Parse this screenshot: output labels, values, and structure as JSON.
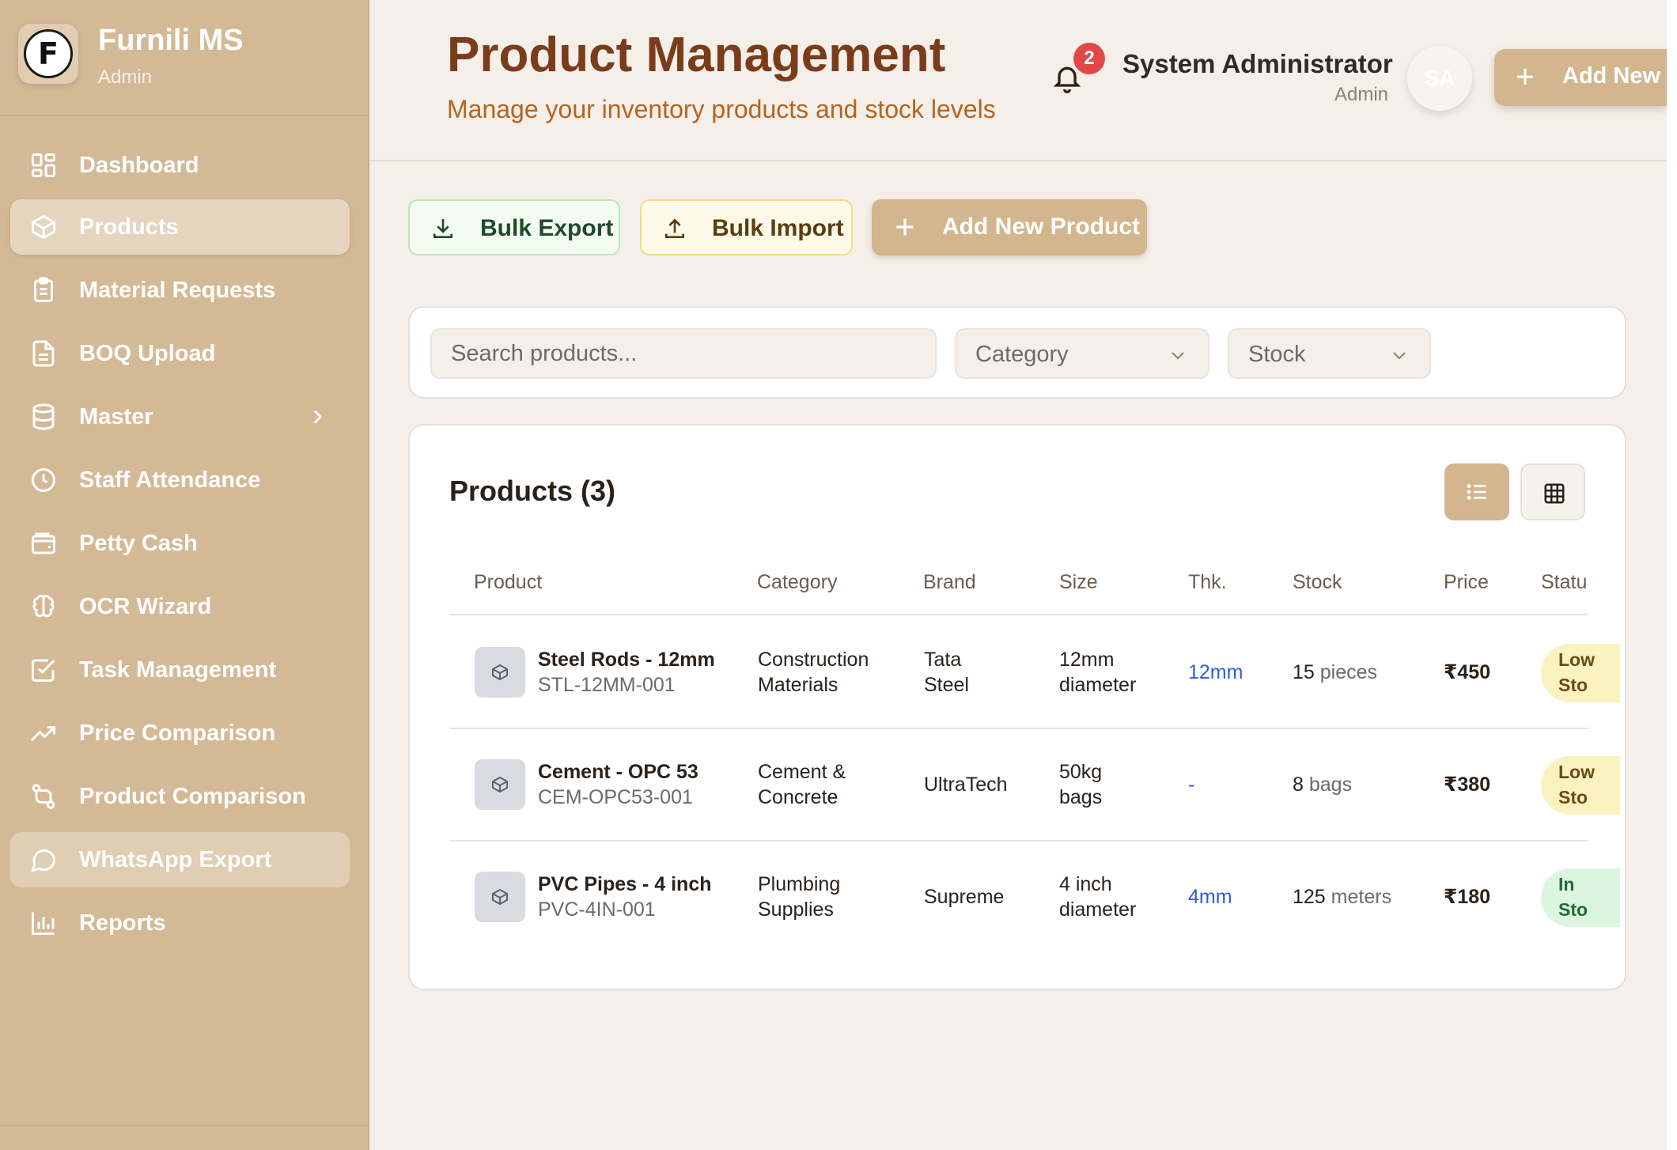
{
  "brand": {
    "name": "Furnili MS",
    "role": "Admin",
    "logo_letter": "F"
  },
  "sidebar": {
    "items": [
      {
        "label": "Dashboard",
        "icon": "dashboard-grid-icon"
      },
      {
        "label": "Products",
        "icon": "box-icon",
        "active": true
      },
      {
        "label": "Material Requests",
        "icon": "clipboard-icon"
      },
      {
        "label": "BOQ Upload",
        "icon": "file-icon"
      },
      {
        "label": "Master",
        "icon": "database-icon",
        "has_submenu": true
      },
      {
        "label": "Staff Attendance",
        "icon": "clock-icon"
      },
      {
        "label": "Petty Cash",
        "icon": "wallet-icon"
      },
      {
        "label": "OCR Wizard",
        "icon": "brain-icon"
      },
      {
        "label": "Task Management",
        "icon": "checkbox-icon"
      },
      {
        "label": "Price Comparison",
        "icon": "trending-up-icon"
      },
      {
        "label": "Product Comparison",
        "icon": "compare-icon"
      },
      {
        "label": "WhatsApp Export",
        "icon": "chat-bubble-icon",
        "highlighted": true
      },
      {
        "label": "Reports",
        "icon": "bar-chart-icon"
      }
    ]
  },
  "header": {
    "title": "Product Management",
    "subtitle": "Manage your inventory products and stock levels",
    "notification_count": "2",
    "user_name": "System Administrator",
    "user_role": "Admin",
    "avatar_initials": "SA",
    "add_button_label": "Add New"
  },
  "actions": {
    "export_label": "Bulk Export",
    "import_label": "Bulk Import",
    "add_label": "Add New Product"
  },
  "filters": {
    "search_placeholder": "Search products...",
    "category_label": "Category",
    "stock_label": "Stock"
  },
  "products": {
    "title": "Products (3)",
    "columns": [
      "Product",
      "Category",
      "Brand",
      "Size",
      "Thk.",
      "Stock",
      "Price",
      "Statu"
    ],
    "rows": [
      {
        "name": "Steel Rods - 12mm",
        "sku": "STL-12MM-001",
        "category": [
          "Construction",
          "Materials"
        ],
        "brand": [
          "Tata",
          "Steel"
        ],
        "size": [
          "12mm",
          "diameter"
        ],
        "thickness": "12mm",
        "stock_qty": "15",
        "stock_unit": "pieces",
        "price": "₹450",
        "status": [
          "Low",
          "Sto"
        ],
        "status_type": "low"
      },
      {
        "name": "Cement - OPC 53",
        "sku": "CEM-OPC53-001",
        "category": [
          "Cement &",
          "Concrete"
        ],
        "brand": [
          "UltraTech"
        ],
        "size": [
          "50kg",
          "bags"
        ],
        "thickness": "-",
        "stock_qty": "8",
        "stock_unit": "bags",
        "price": "₹380",
        "status": [
          "Low",
          "Sto"
        ],
        "status_type": "low"
      },
      {
        "name": "PVC Pipes - 4 inch",
        "sku": "PVC-4IN-001",
        "category": [
          "Plumbing",
          "Supplies"
        ],
        "brand": [
          "Supreme"
        ],
        "size": [
          "4 inch",
          "diameter"
        ],
        "thickness": "4mm",
        "stock_qty": "125",
        "stock_unit": "meters",
        "price": "₹180",
        "status": [
          "In",
          "Sto"
        ],
        "status_type": "in"
      }
    ]
  },
  "colors": {
    "sidebar_bg": "#d4b996",
    "accent": "#d3b68d",
    "title": "#7a3c1a",
    "subtitle": "#b56420",
    "link_blue": "#2f5ed6",
    "low_stock_bg": "#fbf2c2",
    "in_stock_bg": "#dcf5df"
  }
}
